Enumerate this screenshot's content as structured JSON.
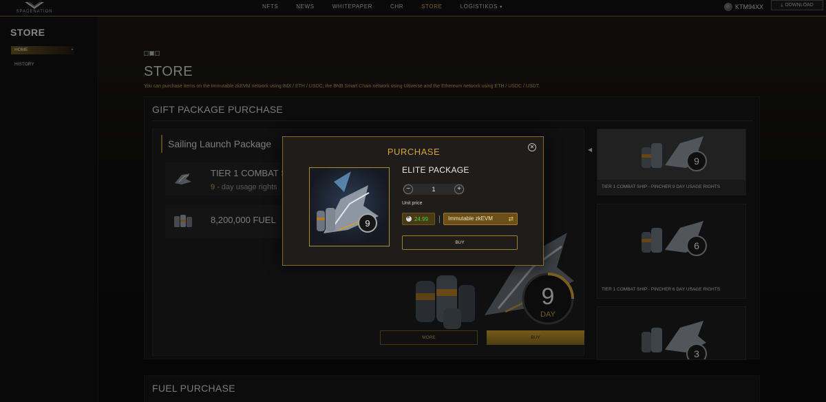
{
  "header": {
    "logo_text": "SPACENATION",
    "nav": [
      {
        "label": "NFTS"
      },
      {
        "label": "NEWS"
      },
      {
        "label": "WHITEPAPER"
      },
      {
        "label": "CHR"
      },
      {
        "label": "STORE"
      },
      {
        "label": "LOGISTIKOS"
      }
    ],
    "active_nav": "STORE",
    "username": "KTM94XX",
    "download_label": "DOWNLOAD"
  },
  "sidebar": {
    "title": "STORE",
    "items": [
      {
        "label": "HOME"
      },
      {
        "label": "HISTORY"
      }
    ]
  },
  "main": {
    "title": "STORE",
    "description": "You can purchase items on the Immutable zkEVM network using IMX / ETH / USDC, the BNB Smart Chain network using Ultiverse and the Ethereum network using ETH / USDC / USDT.",
    "gift": {
      "title": "GIFT PACKAGE PURCHASE",
      "package_name": "Sailing Launch Package",
      "rows": [
        {
          "title": "TIER 1 COMBAT S",
          "sub_num": "9",
          "sub_text": "- day usage rights"
        },
        {
          "title": "8,200,000 FUEL"
        }
      ],
      "hero_number": "9",
      "hero_unit": "DAY",
      "more_label": "MORE",
      "buy_label": "BUY",
      "side_cards": [
        {
          "label": "TIER 1 COMBAT SHIP - PINCHER 9 DAY USAGE RIGHTS",
          "number": "9"
        },
        {
          "label": "TIER 1 COMBAT SHIP - PINCHER 6 DAY USAGE RIGHTS",
          "number": "6"
        },
        {
          "label": "",
          "number": "3"
        }
      ]
    },
    "fuel": {
      "title": "FUEL PURCHASE"
    }
  },
  "modal": {
    "title": "PURCHASE",
    "item_name": "ELITE PACKAGE",
    "quantity": "1",
    "unit_price_label": "Unit price",
    "price": "24.99",
    "network": "Immutable zkEVM",
    "buy_label": "BUY",
    "badge_number": "9"
  },
  "colors": {
    "accent": "#d4a43b",
    "price_green": "#3fd14a",
    "border_gold": "#8a6e28"
  }
}
